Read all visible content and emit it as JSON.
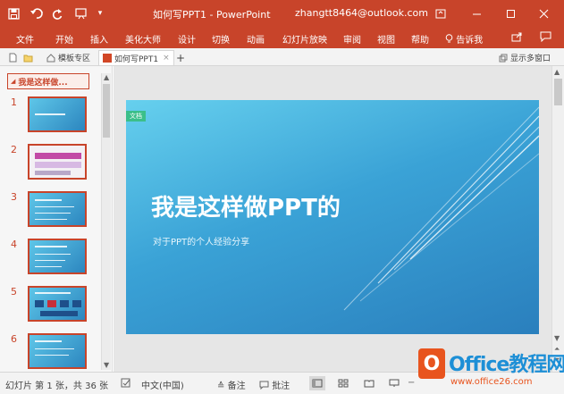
{
  "titlebar": {
    "title": "如何写PPT1  -  PowerPoint",
    "user_email": "zhangtt8464@outlook.com",
    "save_icon": "save-icon",
    "undo_icon": "undo-icon",
    "redo_icon": "redo-icon",
    "customize_icon": "customize-quick-access-icon",
    "ribbon_display_icon": "ribbon-display-options-icon",
    "minimize_icon": "minimize-icon",
    "maximize_icon": "maximize-icon",
    "close_icon": "close-icon"
  },
  "ribbon": {
    "tabs": [
      "文件",
      "开始",
      "插入",
      "美化大师",
      "设计",
      "切换",
      "动画",
      "幻灯片放映",
      "审阅",
      "视图",
      "帮助"
    ],
    "tell_me": "告诉我"
  },
  "tabstrip": {
    "template_tab": "模板专区",
    "doc_tab": "如何写PPT1",
    "add": "+",
    "show_windows": "显示多窗口"
  },
  "thumbnails": {
    "section_label": "我是这样做...",
    "slides": [
      "1",
      "2",
      "3",
      "4",
      "5",
      "6"
    ]
  },
  "slide": {
    "tag": "文档",
    "title": "我是这样做PPT的",
    "subtitle": "对于PPT的个人经验分享"
  },
  "statusbar": {
    "slide_info": "幻灯片 第 1 张，共 36 张",
    "language": "中文(中国)",
    "notes": "备注",
    "comments": "批注"
  },
  "watermark": {
    "brand": "Office教程网",
    "url": "www.office26.com"
  },
  "colors": {
    "accent": "#c8442a",
    "slide_top": "#66d0ee",
    "slide_bottom": "#2a7fbd"
  }
}
